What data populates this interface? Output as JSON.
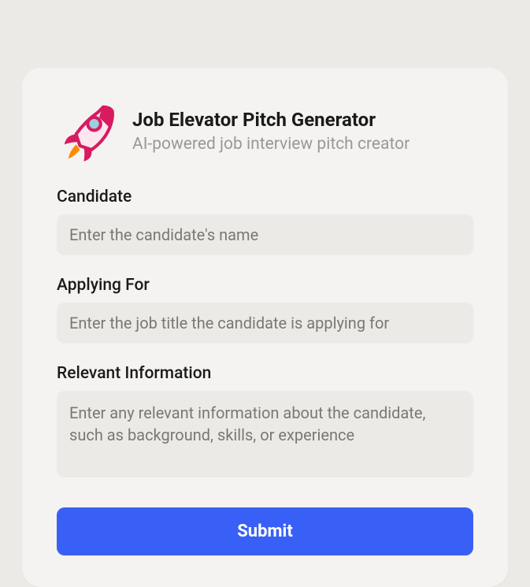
{
  "header": {
    "title": "Job Elevator Pitch Generator",
    "subtitle": "AI-powered job interview pitch creator"
  },
  "fields": {
    "candidate": {
      "label": "Candidate",
      "placeholder": "Enter the candidate's name",
      "value": ""
    },
    "applying_for": {
      "label": "Applying For",
      "placeholder": "Enter the job title the candidate is applying for",
      "value": ""
    },
    "relevant_info": {
      "label": "Relevant Information",
      "placeholder": "Enter any relevant information about the candidate, such as background, skills, or experience",
      "value": ""
    }
  },
  "submit_label": "Submit",
  "icon": "rocket-icon",
  "colors": {
    "accent": "#3960f6",
    "rocket_body": "#d81b60",
    "rocket_flame": "#ff8a00"
  }
}
